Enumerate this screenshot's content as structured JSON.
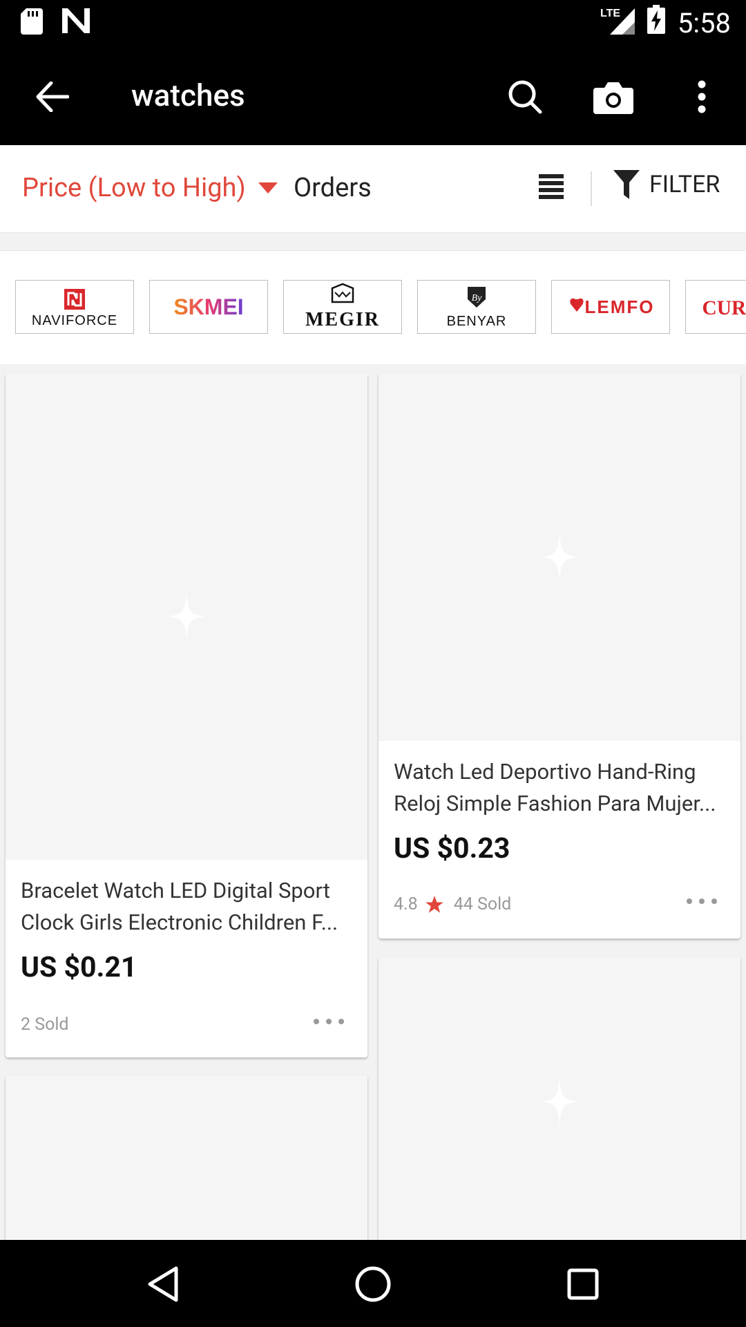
{
  "status_bar": {
    "time": "5:58",
    "network": "LTE",
    "icons": [
      "sd-card-icon",
      "n-notification-icon",
      "signal-icon",
      "battery-charging-icon"
    ]
  },
  "app_bar": {
    "title": "watches",
    "icons": [
      "back-arrow-icon",
      "search-icon",
      "camera-icon",
      "more-vert-icon"
    ]
  },
  "sort_bar": {
    "active_sort": "Price (Low to High)",
    "orders_label": "Orders",
    "filter_label": "FILTER",
    "accent_color": "#e0473a"
  },
  "brands": [
    {
      "name": "NAVIFORCE",
      "logo_text": "NAVIFORCE"
    },
    {
      "name": "SKMEI",
      "logo_text": "SKMEI"
    },
    {
      "name": "MEGIR",
      "logo_text": "MEGIR"
    },
    {
      "name": "BENYAR",
      "logo_text": "BENYAR"
    },
    {
      "name": "LEMFO",
      "logo_text": "LEMFO"
    },
    {
      "name": "CURREN",
      "logo_text": "CUR"
    }
  ],
  "products": [
    {
      "title_line1": "Bracelet Watch LED Digital Sport",
      "title_line2": "Clock Girls Electronic Children F...",
      "price": "US $0.21",
      "rating": "",
      "sold": "2 Sold"
    },
    {
      "title_line1": "Watch Led Deportivo Hand-Ring",
      "title_line2": "Reloj Simple Fashion Para Mujer...",
      "price": "US $0.23",
      "rating": "4.8",
      "sold": "44 Sold"
    }
  ],
  "nav_bar": {
    "icons": [
      "back-triangle-icon",
      "home-circle-icon",
      "recents-square-icon"
    ]
  }
}
